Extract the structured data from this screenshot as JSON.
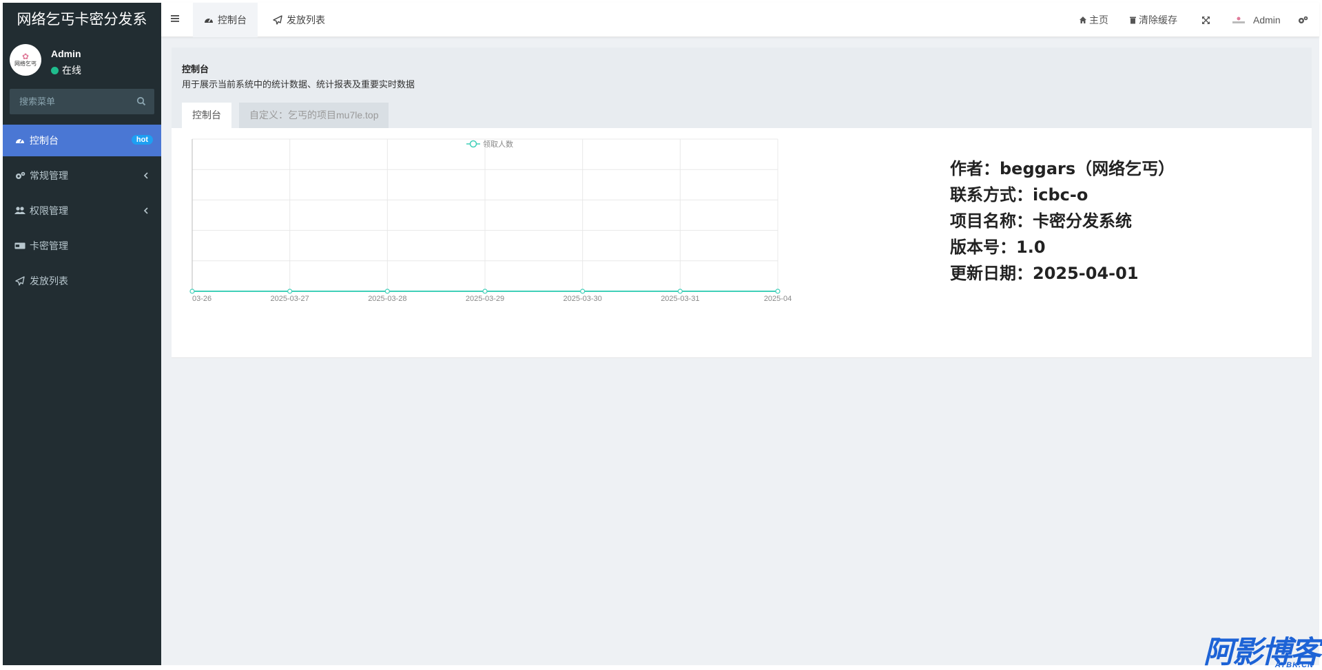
{
  "app": {
    "title": "网络乞丐卡密分发系"
  },
  "user": {
    "name": "Admin",
    "status": "在线",
    "avatar_text": "网络乞丐"
  },
  "sidebar": {
    "search_placeholder": "搜索菜单",
    "items": [
      {
        "label": "控制台",
        "icon": "dashboard-icon",
        "badge": "hot"
      },
      {
        "label": "常规管理",
        "icon": "cogs-icon"
      },
      {
        "label": "权限管理",
        "icon": "users-icon"
      },
      {
        "label": "卡密管理",
        "icon": "card-icon"
      },
      {
        "label": "发放列表",
        "icon": "paper-plane-icon"
      }
    ]
  },
  "topbar": {
    "tabs": [
      {
        "label": "控制台",
        "icon": "dashboard-icon"
      },
      {
        "label": "发放列表",
        "icon": "paper-plane-icon"
      }
    ],
    "home_label": "主页",
    "clear_cache_label": "清除缓存",
    "admin_label": "Admin"
  },
  "content": {
    "title": "控制台",
    "description": "用于展示当前系统中的统计数据、统计报表及重要实时数据",
    "tabs": [
      "控制台",
      "自定义：乞丐的项目mu7le.top"
    ]
  },
  "info": [
    "作者：beggars（网络乞丐）",
    "联系方式：icbc-o",
    "项目名称：卡密分发系统",
    "版本号：1.0",
    "更新日期：2025-04-01"
  ],
  "chart_data": {
    "type": "line",
    "x_tick_labels": [
      "03-26",
      "2025-03-27",
      "2025-03-28",
      "2025-03-29",
      "2025-03-30",
      "2025-03-31",
      "2025-04"
    ],
    "x": [
      "2025-03-26",
      "2025-03-27",
      "2025-03-28",
      "2025-03-29",
      "2025-03-30",
      "2025-03-31",
      "2025-04-01"
    ],
    "series": [
      {
        "name": "领取人数",
        "values": [
          0,
          0,
          0,
          0,
          0,
          0,
          0
        ]
      }
    ],
    "ylim": [
      0,
      5
    ],
    "grid": true,
    "legend": "top-center",
    "color": "#3fcfb8"
  },
  "watermark": {
    "big": "阿影博客",
    "small": "AYBK.CN"
  }
}
